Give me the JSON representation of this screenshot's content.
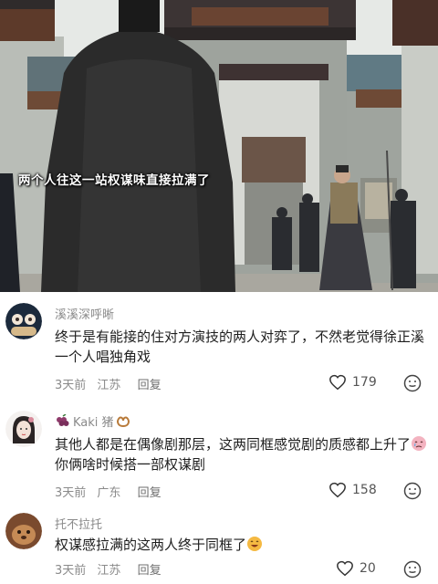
{
  "video": {
    "subtitle": "两个人往这一站权谋味直接拉满了"
  },
  "comments": [
    {
      "username": "溪溪深呼晰",
      "text": "终于是有能接的住对方演技的两人对弈了，不然老觉得徐正溪一个人唱独角戏",
      "time": "3天前",
      "location": "江苏",
      "reply_label": "回复",
      "likes": "179"
    },
    {
      "username": "Kaki 猪",
      "text_part1": "其他人都是在偶像剧那层，这两同框感觉剧的质感都上升了",
      "text_part2": "你俩啥时候搭一部权谋剧",
      "time": "3天前",
      "location": "广东",
      "reply_label": "回复",
      "likes": "158"
    },
    {
      "username": "托不拉托",
      "text": "权谋感拉满的这两人终于同框了",
      "time": "3天前",
      "location": "江苏",
      "reply_label": "回复",
      "likes": "20"
    }
  ]
}
